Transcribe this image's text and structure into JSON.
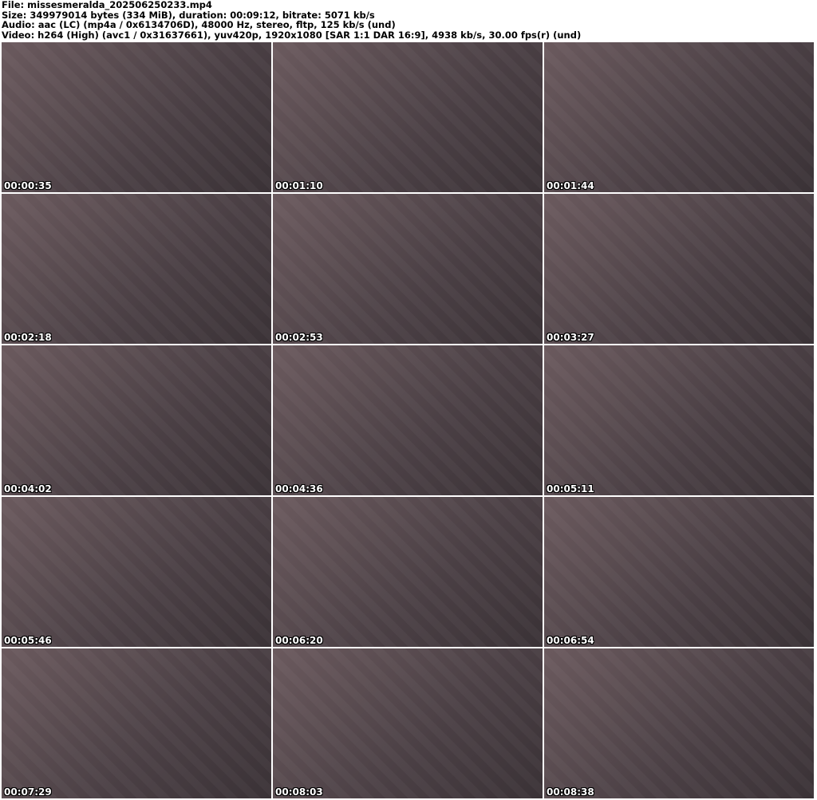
{
  "header": {
    "file": "File: missesmeralda_202506250233.mp4",
    "size": "Size: 349979014 bytes (334 MiB), duration: 00:09:12, bitrate: 5071 kb/s",
    "audio": "Audio: aac (LC) (mp4a / 0x6134706D), 48000 Hz, stereo, fltp, 125 kb/s (und)",
    "video": "Video: h264 (High) (avc1 / 0x31637661), yuv420p, 1920x1080 [SAR 1:1 DAR 16:9], 4938 kb/s, 30.00 fps(r) (und)"
  },
  "thumbnails": [
    {
      "timestamp": "00:00:35"
    },
    {
      "timestamp": "00:01:10"
    },
    {
      "timestamp": "00:01:44"
    },
    {
      "timestamp": "00:02:18"
    },
    {
      "timestamp": "00:02:53"
    },
    {
      "timestamp": "00:03:27"
    },
    {
      "timestamp": "00:04:02"
    },
    {
      "timestamp": "00:04:36"
    },
    {
      "timestamp": "00:05:11"
    },
    {
      "timestamp": "00:05:46"
    },
    {
      "timestamp": "00:06:20"
    },
    {
      "timestamp": "00:06:54"
    },
    {
      "timestamp": "00:07:29"
    },
    {
      "timestamp": "00:08:03"
    },
    {
      "timestamp": "00:08:38"
    }
  ]
}
